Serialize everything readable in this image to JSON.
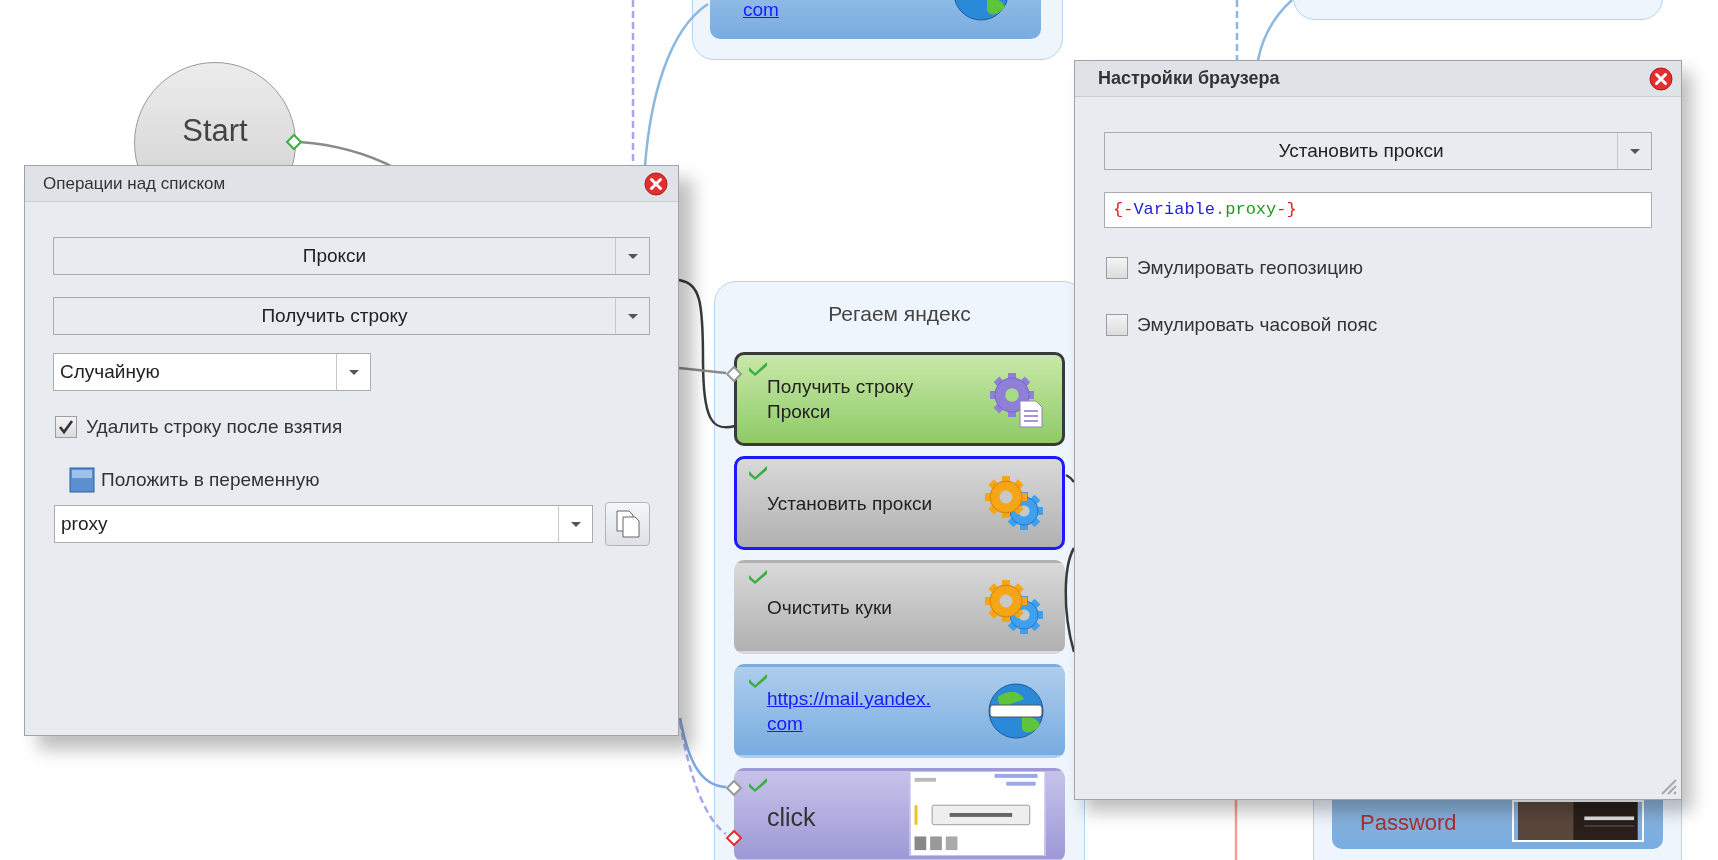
{
  "canvas": {
    "start_node": {
      "label": "Start"
    },
    "top_node": {
      "link": "com"
    },
    "group": {
      "title": "Регаем яндекс",
      "nodes": [
        {
          "kind": "list",
          "label": "Получить строку\nПрокси",
          "selected": false,
          "highlighted": true
        },
        {
          "kind": "action",
          "label": "Установить прокси",
          "selected": true,
          "highlighted": false
        },
        {
          "kind": "action",
          "label": "Очистить куки",
          "selected": false,
          "highlighted": false
        },
        {
          "kind": "navigate",
          "label": "https://mail.yandex.\ncom",
          "selected": false,
          "highlighted": false
        },
        {
          "kind": "click",
          "label": "click",
          "selected": false,
          "highlighted": false
        }
      ]
    },
    "bottom_node": {
      "label": "Password"
    }
  },
  "list_dialog": {
    "title": "Операции над списком",
    "list_select": "Прокси",
    "operation_select": "Получить строку",
    "mode_select": "Случайную",
    "delete_after_take": {
      "label": "Удалить строку после взятия",
      "checked": true
    },
    "save_to_variable": {
      "label": "Положить в переменную"
    },
    "variable": "proxy"
  },
  "browser_dialog": {
    "title": "Настройки браузера",
    "action_select": "Установить прокси",
    "proxy_value": [
      {
        "text": "{-",
        "color": "#e02020"
      },
      {
        "text": "Variable",
        "color": "#2323d8"
      },
      {
        "text": "."
      },
      {
        "text": "proxy",
        "color": "#1f9a1f"
      },
      {
        "text": "-}",
        "color": "#e02020"
      }
    ],
    "options": [
      {
        "label": "Эмулировать геопозицию",
        "checked": false
      },
      {
        "label": "Эмулировать часовой пояс",
        "checked": false
      }
    ]
  }
}
